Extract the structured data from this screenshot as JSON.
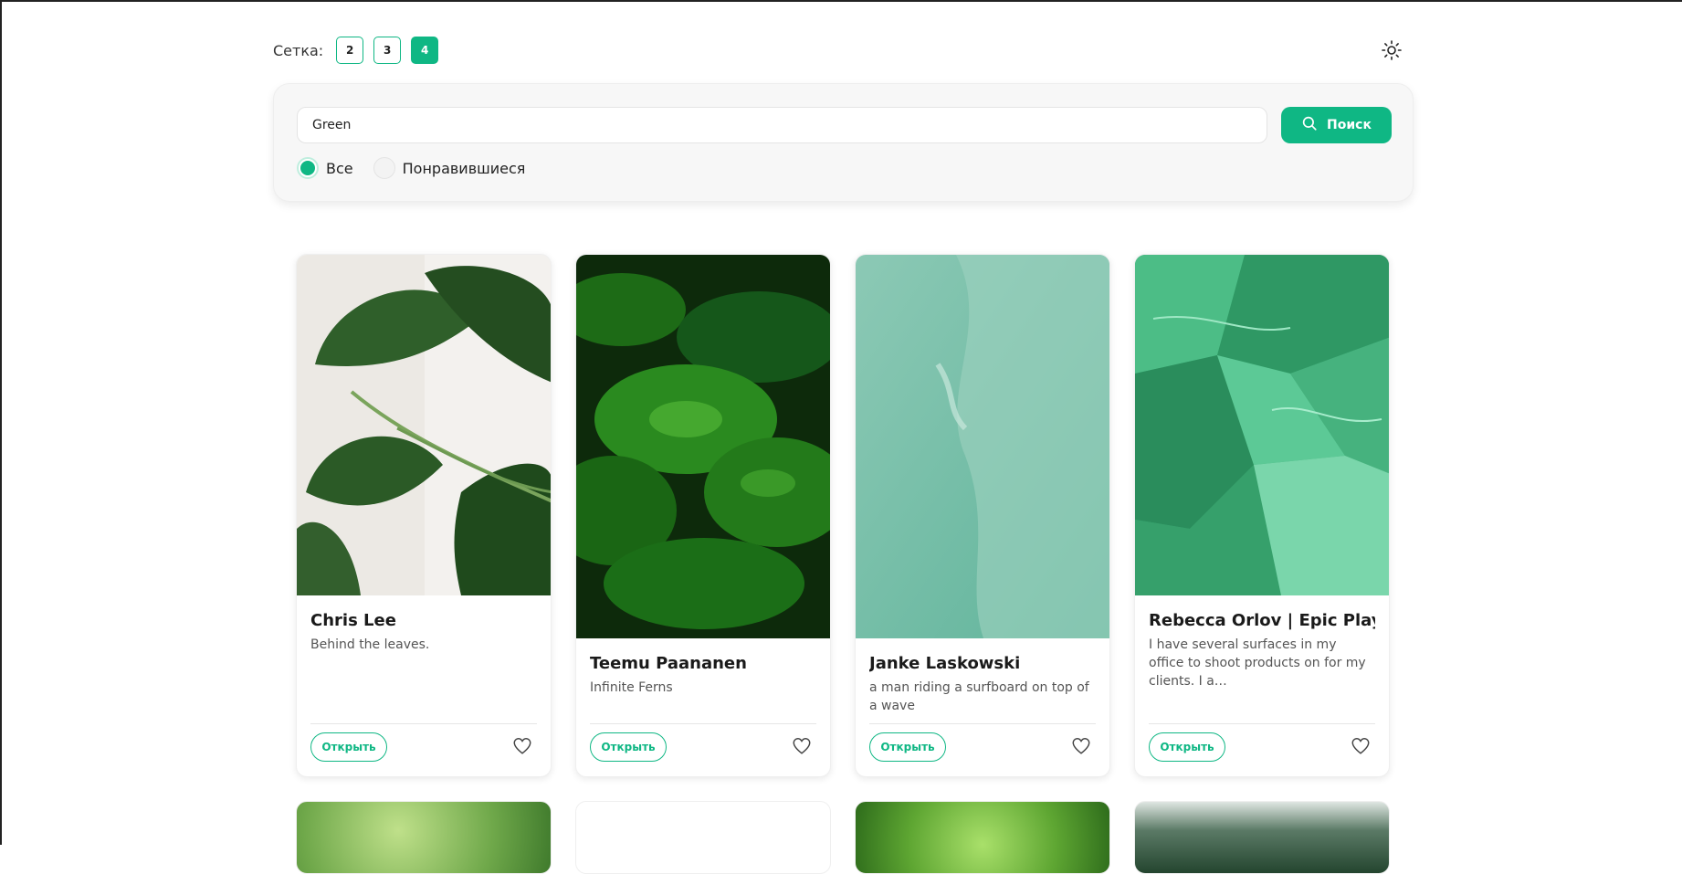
{
  "grid": {
    "label": "Сетка:",
    "options": [
      "2",
      "3",
      "4"
    ],
    "active": "4"
  },
  "search": {
    "value": "Green",
    "placeholder": "",
    "button_label": "Поиск"
  },
  "filters": {
    "all_label": "Все",
    "liked_label": "Понравившиеся",
    "selected": "Все"
  },
  "cards": [
    {
      "title": "Chris Lee",
      "description": "Behind the leaves.",
      "open_label": "Открыть"
    },
    {
      "title": "Teemu Paananen",
      "description": "Infinite Ferns",
      "open_label": "Открыть"
    },
    {
      "title": "Janke Laskowski",
      "description": "a man riding a surfboard on top of a wave",
      "open_label": "Открыть"
    },
    {
      "title": "Rebecca Orlov | Epic Playdate",
      "description": "I have several surfaces in my office to shoot products on for my clients. I a…",
      "open_label": "Открыть"
    }
  ],
  "colors": {
    "accent": "#0fb784",
    "background": "#ffffff",
    "panel": "#f7f7f7"
  },
  "icons": {
    "theme": "sun-icon",
    "search": "search-icon",
    "like": "heart-icon"
  }
}
